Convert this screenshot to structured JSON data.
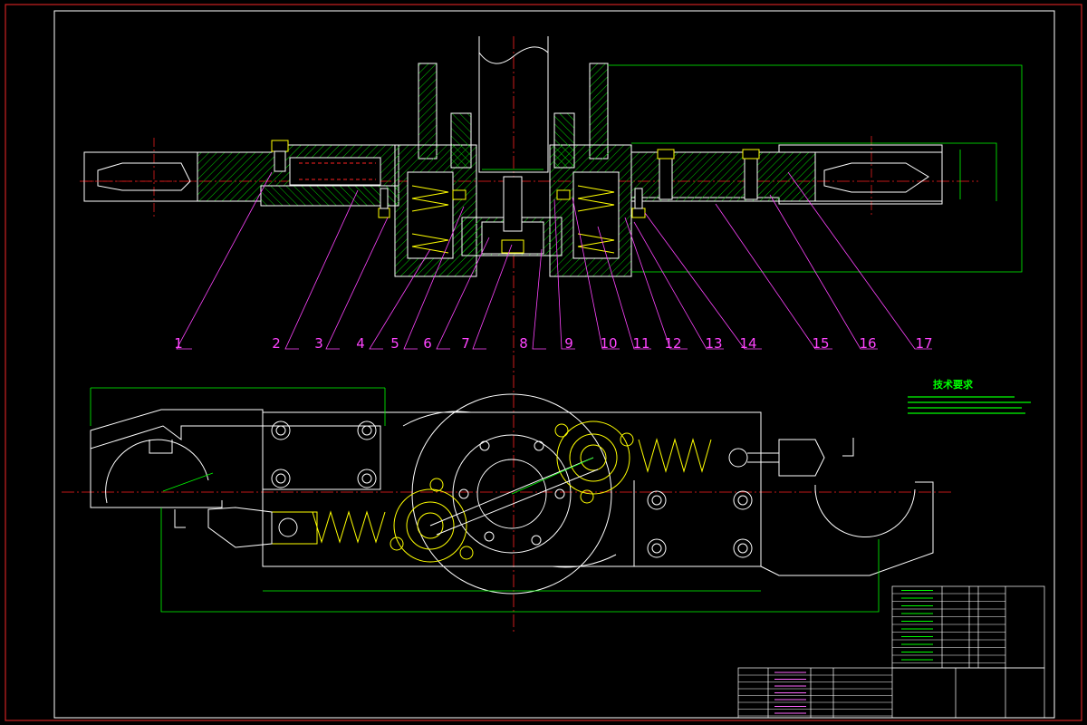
{
  "drawing": {
    "part_labels": [
      "1",
      "2",
      "3",
      "4",
      "5",
      "6",
      "7",
      "8",
      "9",
      "10",
      "11",
      "12",
      "13",
      "14",
      "15",
      "16",
      "17"
    ],
    "tech_requirements_title": "技术要求"
  },
  "colors": {
    "background": "#000000",
    "frame": "#cc2222",
    "outline": "#ffffff",
    "dimension": "#00ff00",
    "leader": "#ff44ff",
    "hidden": "#ff2222",
    "spring": "#ffff00",
    "hatch": "#00ff00"
  }
}
